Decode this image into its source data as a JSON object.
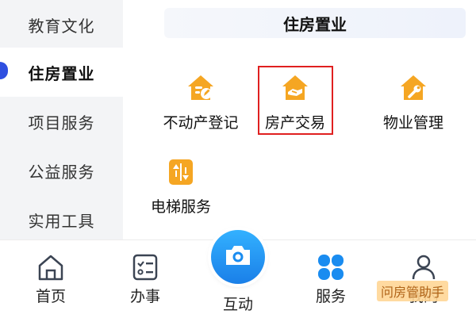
{
  "sidebar": {
    "items": [
      {
        "label": "教育文化"
      },
      {
        "label": "住房置业"
      },
      {
        "label": "项目服务"
      },
      {
        "label": "公益服务"
      },
      {
        "label": "实用工具"
      }
    ],
    "active_index": 1
  },
  "panel": {
    "title": "住房置业",
    "services": [
      {
        "label": "不动产登记",
        "icon": "house-pencil-icon"
      },
      {
        "label": "房产交易",
        "icon": "house-handshake-icon"
      },
      {
        "label": "物业管理",
        "icon": "house-wrench-icon"
      },
      {
        "label": "电梯服务",
        "icon": "elevator-icon"
      }
    ],
    "highlighted": "房产交易"
  },
  "bottom_nav": {
    "tabs": [
      {
        "label": "首页",
        "icon": "home-icon"
      },
      {
        "label": "办事",
        "icon": "checklist-icon"
      },
      {
        "label": "互动",
        "icon": "camera-icon"
      },
      {
        "label": "服务",
        "icon": "grid-icon"
      },
      {
        "label": "我的",
        "icon": "user-icon"
      }
    ]
  },
  "watermark": "问房管助手",
  "colors": {
    "accent": "#2f4fe0",
    "icon_orange": "#f5a623",
    "camera_blue": "#1a8cf0",
    "highlight_red": "#e02020"
  }
}
